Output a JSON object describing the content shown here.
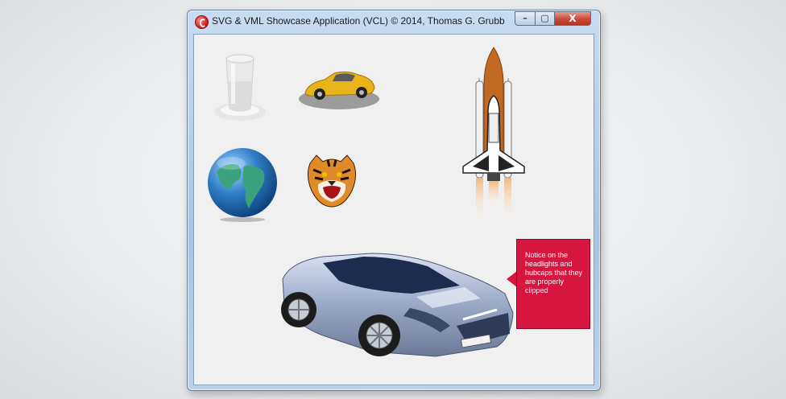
{
  "window": {
    "title": "SVG & VML Showcase Application (VCL) © 2014, Thomas G. Grubb",
    "controls": {
      "minimize": "–",
      "maximize": "▢",
      "close": "X"
    }
  },
  "callout": {
    "text": "Notice on the headlights and hubcaps that they are properly clipped"
  },
  "colors": {
    "callout": "#d6163f",
    "title_bar": "#b8cfe8",
    "client": "#f0f0f0"
  }
}
